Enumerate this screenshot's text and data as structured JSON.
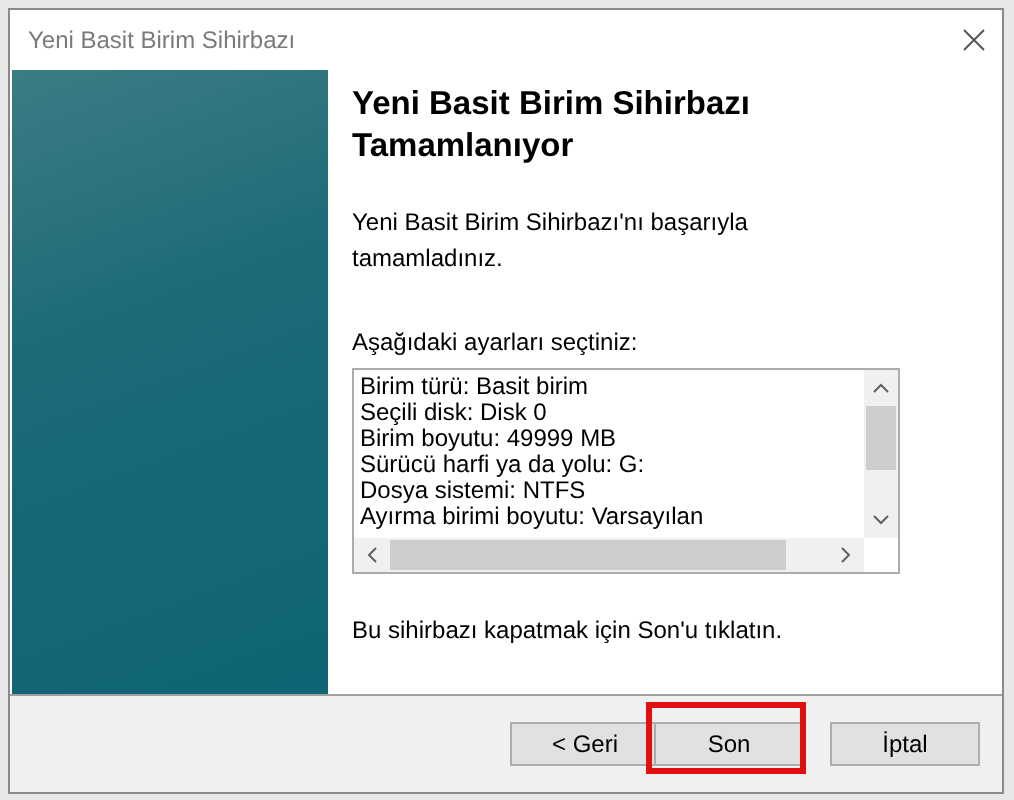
{
  "window": {
    "title": "Yeni Basit Birim Sihirbazı"
  },
  "heading": "Yeni Basit Birim Sihirbazı Tamamlanıyor",
  "intro": "Yeni Basit Birim Sihirbazı'nı başarıyla tamamladınız.",
  "settings_label": "Aşağıdaki ayarları seçtiniz:",
  "settings": [
    "Birim türü: Basit birim",
    "Seçili disk: Disk 0",
    "Birim boyutu: 49999 MB",
    "Sürücü harfi ya da yolu: G:",
    "Dosya sistemi: NTFS",
    "Ayırma birimi boyutu: Varsayılan"
  ],
  "closing_note": "Bu sihirbazı kapatmak için Son'u tıklatın.",
  "buttons": [
    {
      "label": "< Geri",
      "highlighted": false
    },
    {
      "label": "Son",
      "highlighted": true
    },
    {
      "label": "İptal",
      "highlighted": false
    }
  ]
}
